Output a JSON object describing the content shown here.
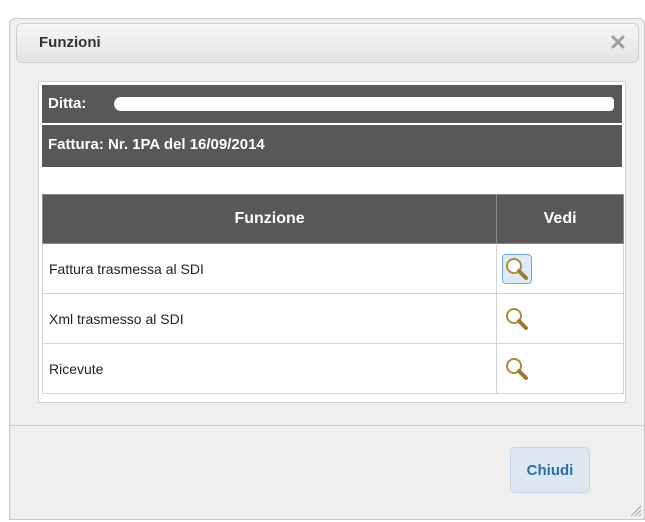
{
  "dialog": {
    "title": "Funzioni",
    "close_icon": "close-icon"
  },
  "header": {
    "ditta_label": "Ditta:",
    "fattura_label": "Fattura: Nr. 1PA del 16/09/2014"
  },
  "table": {
    "columns": [
      "Funzione",
      "Vedi"
    ],
    "rows": [
      {
        "label": "Fattura trasmessa al SDI",
        "icon": "magnifier-icon"
      },
      {
        "label": "Xml trasmesso al SDI",
        "icon": "magnifier-icon"
      },
      {
        "label": "Ricevute",
        "icon": "magnifier-icon"
      }
    ]
  },
  "footer": {
    "close_button_label": "Chiudi"
  },
  "colors": {
    "band": "#585858",
    "button_text": "#2e6ea6",
    "button_bg": "#dde8f2"
  }
}
